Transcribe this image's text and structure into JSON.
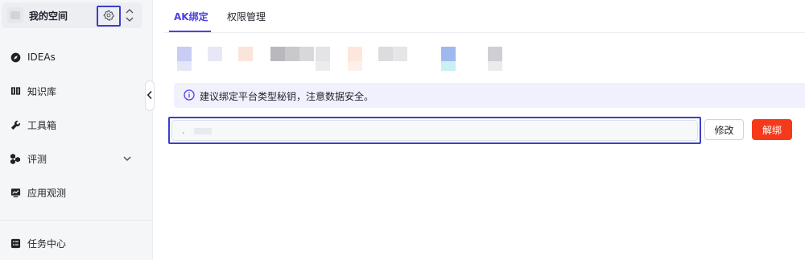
{
  "sidebar": {
    "space": {
      "name": "我的空间"
    },
    "items": [
      {
        "label": "IDEAs",
        "icon": "compass-icon"
      },
      {
        "label": "知识库",
        "icon": "book-icon"
      },
      {
        "label": "工具箱",
        "icon": "wrench-icon"
      },
      {
        "label": "评测",
        "icon": "cubes-icon",
        "has_chevron": true
      },
      {
        "label": "应用观测",
        "icon": "monitor-chart-icon"
      },
      {
        "label": "任务中心",
        "icon": "task-list-icon"
      }
    ]
  },
  "main": {
    "tabs": [
      {
        "label": "AK绑定",
        "active": true
      },
      {
        "label": "权限管理",
        "active": false
      }
    ],
    "notice": {
      "text": "建议绑定平台类型秘钥，注意数据安全。"
    },
    "ak_input": {
      "value": "."
    },
    "buttons": {
      "edit_label": "修改",
      "unbind_label": "解绑"
    }
  },
  "colors": {
    "accent": "#4e40e5",
    "danger": "#f53a1c",
    "highlight_border": "#3b3fc7",
    "notice_bg": "#f1f0fd"
  }
}
